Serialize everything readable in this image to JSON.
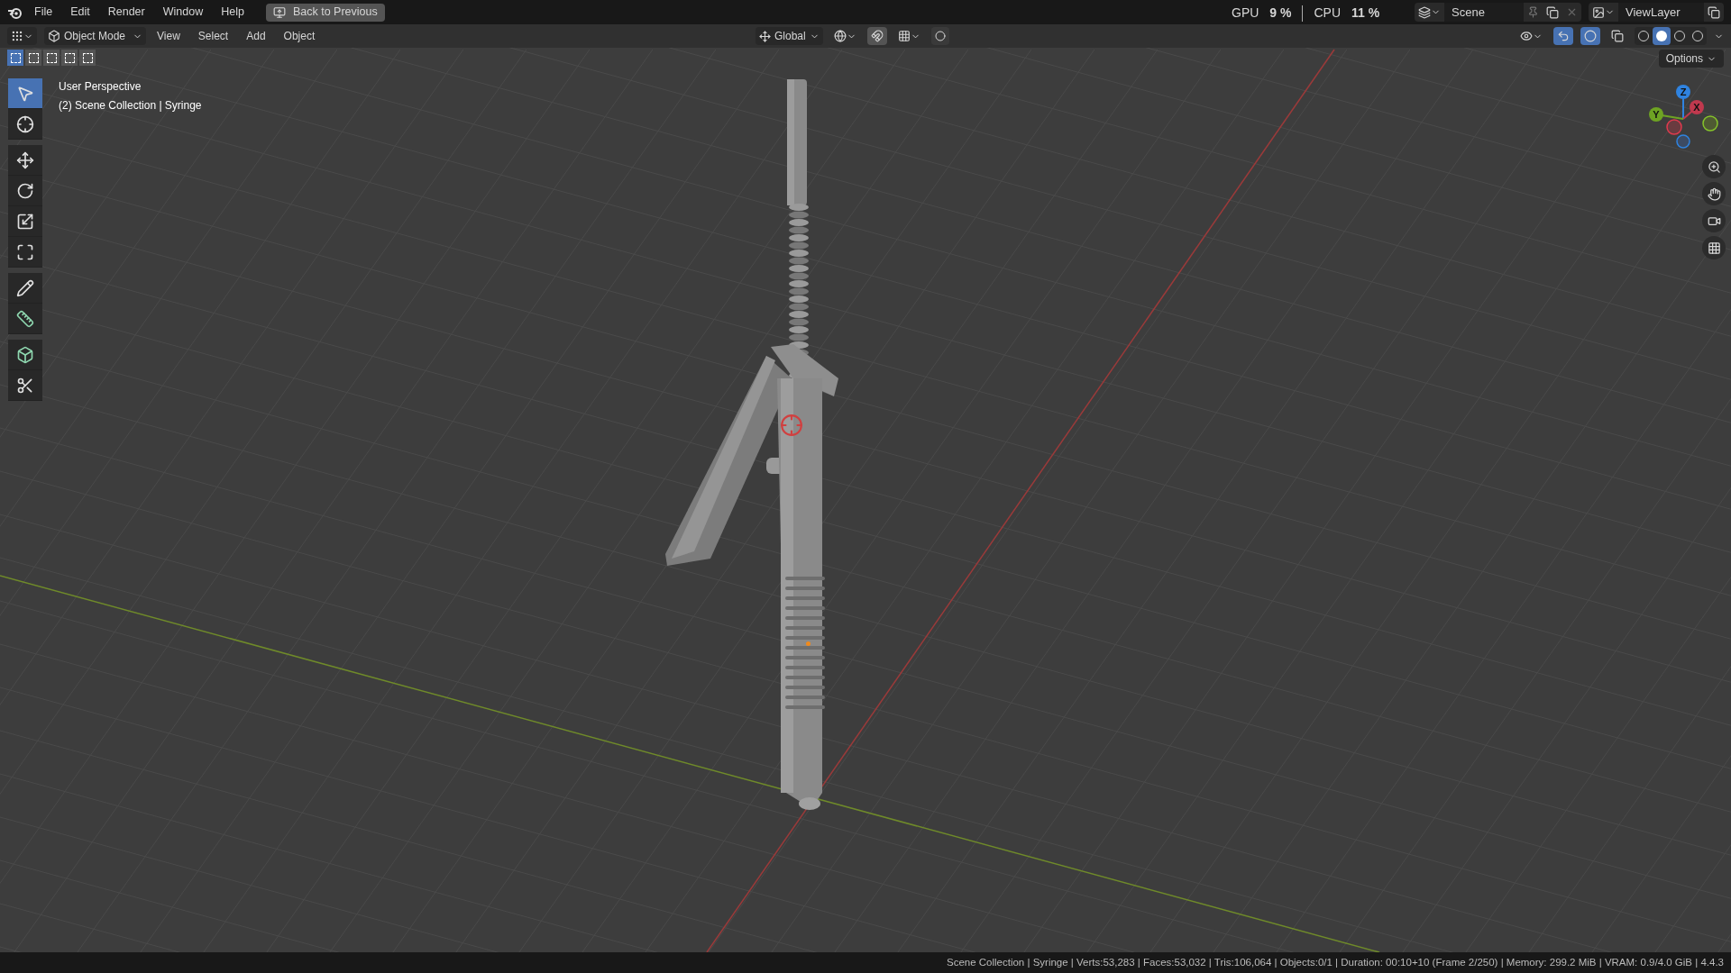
{
  "menu_bar": {
    "items": [
      "File",
      "Edit",
      "Render",
      "Window",
      "Help"
    ],
    "back_button": "Back to Previous"
  },
  "stats": [
    {
      "label": "GPU",
      "value": "9 %"
    },
    {
      "label": "CPU",
      "value": "11 %"
    }
  ],
  "scene": {
    "name": "Scene"
  },
  "view_layer": {
    "name": "ViewLayer"
  },
  "header": {
    "mode": "Object Mode",
    "menus": [
      "View",
      "Select",
      "Add",
      "Object"
    ],
    "orientation": "Global",
    "options": "Options"
  },
  "select_modes": [
    {
      "selected": true
    },
    {
      "selected": false
    },
    {
      "selected": false
    },
    {
      "selected": false
    },
    {
      "selected": false
    }
  ],
  "shading_modes": [
    {
      "selected": false
    },
    {
      "selected": true
    },
    {
      "selected": false
    },
    {
      "selected": false
    }
  ],
  "tools": [
    {
      "kind": "select",
      "selected": true
    },
    {
      "kind": "cursor",
      "selected": false
    },
    {
      "kind": "move",
      "selected": false
    },
    {
      "kind": "rotate",
      "selected": false
    },
    {
      "kind": "scale",
      "selected": false
    },
    {
      "kind": "transform",
      "selected": false
    },
    {
      "kind": "annotate",
      "selected": false
    },
    {
      "kind": "measure",
      "selected": false
    },
    {
      "kind": "add-cube",
      "selected": false
    },
    {
      "kind": "knife",
      "selected": false
    }
  ],
  "viewport": {
    "perspective": "User Perspective",
    "collection": "(2) Scene Collection | Syringe"
  },
  "gizmo": {
    "z": "Z",
    "x": "X",
    "y": "Y"
  },
  "status_bar": "Scene Collection | Syringe | Verts:53,283 | Faces:53,032 | Tris:106,064 | Objects:0/1 | Duration: 00:10+10 (Frame 2/250) | Memory: 299.2 MiB | VRAM: 0.9/4.0 GiB | 4.4.3"
}
